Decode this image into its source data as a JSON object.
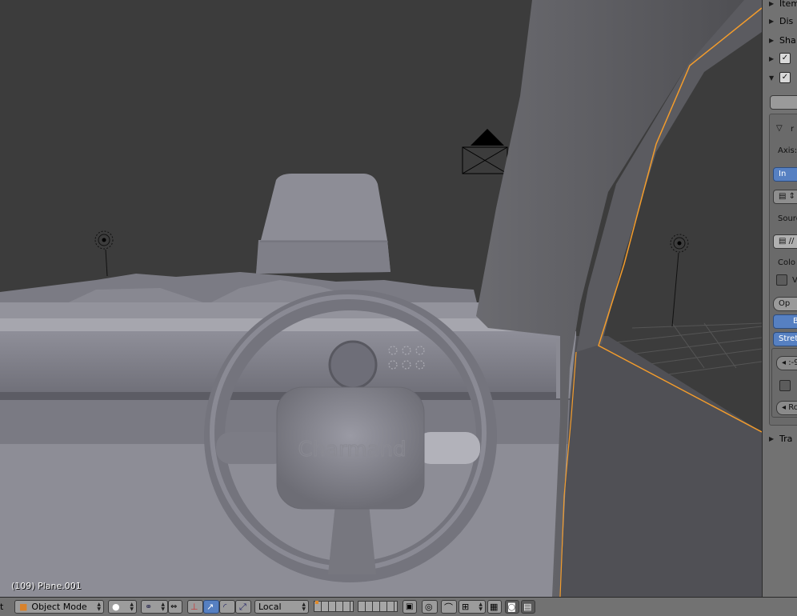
{
  "viewport": {
    "object_info": "(109) Plane.001",
    "steering_wheel_logo": "Charmand"
  },
  "properties_panel": {
    "rows": [
      {
        "label": "Item",
        "expanded": false,
        "checkbox": false
      },
      {
        "label": "Dis",
        "expanded": false,
        "checkbox": false
      },
      {
        "label": "Sha",
        "expanded": false,
        "checkbox": false
      },
      {
        "label": "",
        "expanded": false,
        "checkbox": true
      },
      {
        "label": "",
        "expanded": true,
        "checkbox": true
      }
    ],
    "sub": {
      "axis_label": "Axis:",
      "axis_btn": "In",
      "source_label": "Sourc",
      "source_path": "//",
      "color_label": "Colo",
      "v_label": "V",
      "opacity_btn": "Op",
      "b_btn": "B",
      "stretch_btn": "Stret",
      "field1": ":-9",
      "field2": "Ro"
    },
    "transform_label": "Tra"
  },
  "header": {
    "left_text": "t",
    "mode": "Object Mode",
    "orientation": "Local"
  },
  "colors": {
    "selection_outline": "#f39c2c",
    "header_bg": "#727272",
    "active_button": "#5680c2"
  }
}
